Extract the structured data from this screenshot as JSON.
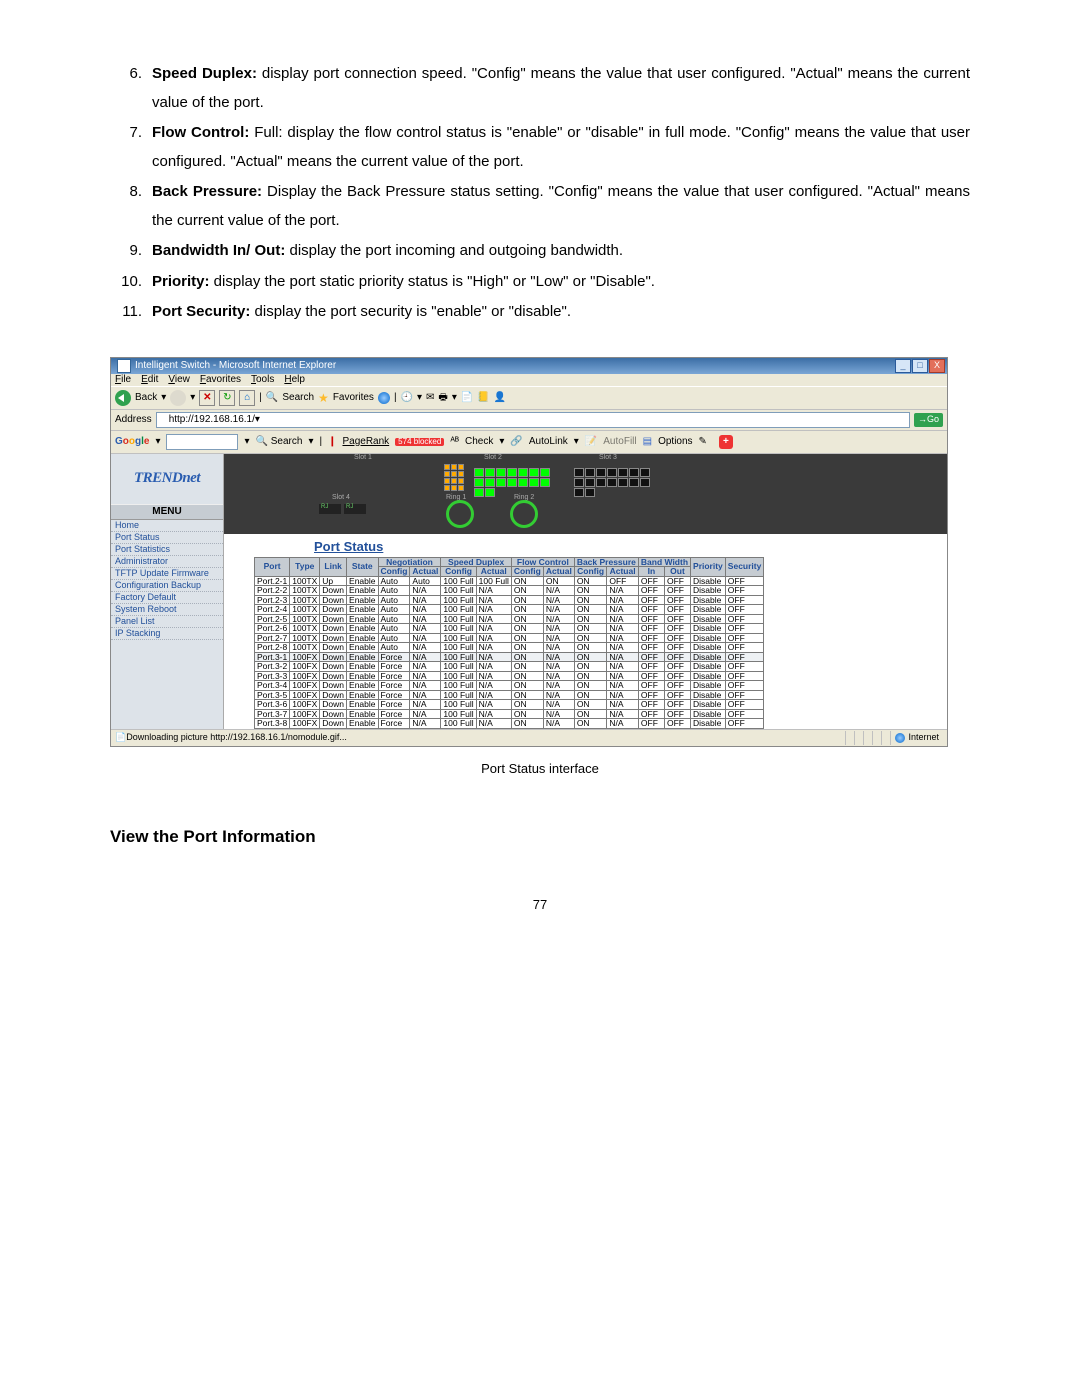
{
  "list": [
    {
      "n": "6.",
      "bold": "Speed Duplex:",
      "text": " display port connection speed. \"Config\" means the value that user configured. \"Actual\" means the current value of the port."
    },
    {
      "n": "7.",
      "bold": "Flow Control:",
      "text": " Full: display the flow control status is \"enable\" or \"disable\" in full mode. \"Config\" means the value that user configured. \"Actual\" means the current value of the port."
    },
    {
      "n": "8.",
      "bold": "Back Pressure:",
      "text": " Display the Back Pressure status setting. \"Config\" means the value that user configured. \"Actual\" means the current value of the port."
    },
    {
      "n": "9.",
      "bold": "Bandwidth In/ Out:",
      "text": " display the port incoming and outgoing bandwidth."
    },
    {
      "n": "10.",
      "bold": "Priority:",
      "text": " display the port static priority status is \"High\" or \"Low\" or \"Disable\"."
    },
    {
      "n": "11.",
      "bold": "Port Security:",
      "text": " display the port security is \"enable\" or \"disable\"."
    }
  ],
  "caption": "Port Status interface",
  "section_heading": "View the Port Information",
  "page_number": "77",
  "browser": {
    "title": "Intelligent Switch - Microsoft Internet Explorer",
    "menus": [
      "File",
      "Edit",
      "View",
      "Favorites",
      "Tools",
      "Help"
    ],
    "back": "Back",
    "search": "Search",
    "favorites": "Favorites",
    "address_label": "Address",
    "address_url": "http://192.168.16.1/",
    "go": "Go",
    "google": {
      "label": "Google",
      "search_btn": "Search",
      "pagerank": "PageRank",
      "blocked": "574 blocked",
      "check": "Check",
      "autolink": "AutoLink",
      "autofill": "AutoFill",
      "options": "Options"
    },
    "status": "Downloading picture http://192.168.16.1/nomodule.gif...",
    "zone": "Internet"
  },
  "sidebar": {
    "logo": "TRENDnet",
    "menu_header": "MENU",
    "items": [
      "Home",
      "Port Status",
      "Port Statistics",
      "Administrator",
      "TFTP Update Firmware",
      "Configuration Backup",
      "Factory Default",
      "System Reboot",
      "Panel List",
      "IP Stacking"
    ]
  },
  "content_title": "Port Status",
  "table": {
    "headers": {
      "port": "Port",
      "type": "Type",
      "link": "Link",
      "state": "State",
      "negotiation": "Negotiation",
      "speed_duplex": "Speed Duplex",
      "flow_control": "Flow Control",
      "back_pressure": "Back Pressure",
      "band_width": "Band Width",
      "priority": "Priority",
      "security": "Security",
      "config": "Config",
      "actual": "Actual",
      "in": "In",
      "out": "Out"
    },
    "rows": [
      {
        "port": "Port.2-1",
        "type": "100TX",
        "link": "Up",
        "state": "Enable",
        "nc": "Auto",
        "na": "Auto",
        "sc": "100 Full",
        "sa": "100 Full",
        "fc": "ON",
        "fa": "ON",
        "bc": "ON",
        "ba": "OFF",
        "bi": "OFF",
        "bo": "OFF",
        "pri": "Disable",
        "sec": "OFF"
      },
      {
        "port": "Port.2-2",
        "type": "100TX",
        "link": "Down",
        "state": "Enable",
        "nc": "Auto",
        "na": "N/A",
        "sc": "100 Full",
        "sa": "N/A",
        "fc": "ON",
        "fa": "N/A",
        "bc": "ON",
        "ba": "N/A",
        "bi": "OFF",
        "bo": "OFF",
        "pri": "Disable",
        "sec": "OFF"
      },
      {
        "port": "Port.2-3",
        "type": "100TX",
        "link": "Down",
        "state": "Enable",
        "nc": "Auto",
        "na": "N/A",
        "sc": "100 Full",
        "sa": "N/A",
        "fc": "ON",
        "fa": "N/A",
        "bc": "ON",
        "ba": "N/A",
        "bi": "OFF",
        "bo": "OFF",
        "pri": "Disable",
        "sec": "OFF"
      },
      {
        "port": "Port.2-4",
        "type": "100TX",
        "link": "Down",
        "state": "Enable",
        "nc": "Auto",
        "na": "N/A",
        "sc": "100 Full",
        "sa": "N/A",
        "fc": "ON",
        "fa": "N/A",
        "bc": "ON",
        "ba": "N/A",
        "bi": "OFF",
        "bo": "OFF",
        "pri": "Disable",
        "sec": "OFF"
      },
      {
        "port": "Port.2-5",
        "type": "100TX",
        "link": "Down",
        "state": "Enable",
        "nc": "Auto",
        "na": "N/A",
        "sc": "100 Full",
        "sa": "N/A",
        "fc": "ON",
        "fa": "N/A",
        "bc": "ON",
        "ba": "N/A",
        "bi": "OFF",
        "bo": "OFF",
        "pri": "Disable",
        "sec": "OFF"
      },
      {
        "port": "Port.2-6",
        "type": "100TX",
        "link": "Down",
        "state": "Enable",
        "nc": "Auto",
        "na": "N/A",
        "sc": "100 Full",
        "sa": "N/A",
        "fc": "ON",
        "fa": "N/A",
        "bc": "ON",
        "ba": "N/A",
        "bi": "OFF",
        "bo": "OFF",
        "pri": "Disable",
        "sec": "OFF"
      },
      {
        "port": "Port.2-7",
        "type": "100TX",
        "link": "Down",
        "state": "Enable",
        "nc": "Auto",
        "na": "N/A",
        "sc": "100 Full",
        "sa": "N/A",
        "fc": "ON",
        "fa": "N/A",
        "bc": "ON",
        "ba": "N/A",
        "bi": "OFF",
        "bo": "OFF",
        "pri": "Disable",
        "sec": "OFF"
      },
      {
        "port": "Port.2-8",
        "type": "100TX",
        "link": "Down",
        "state": "Enable",
        "nc": "Auto",
        "na": "N/A",
        "sc": "100 Full",
        "sa": "N/A",
        "fc": "ON",
        "fa": "N/A",
        "bc": "ON",
        "ba": "N/A",
        "bi": "OFF",
        "bo": "OFF",
        "pri": "Disable",
        "sec": "OFF"
      },
      {
        "port": "Port.3-1",
        "type": "100FX",
        "link": "Down",
        "state": "Enable",
        "nc": "Force",
        "na": "N/A",
        "sc": "100 Full",
        "sa": "N/A",
        "fc": "ON",
        "fa": "N/A",
        "bc": "ON",
        "ba": "N/A",
        "bi": "OFF",
        "bo": "OFF",
        "pri": "Disable",
        "sec": "OFF",
        "alt": true
      },
      {
        "port": "Port.3-2",
        "type": "100FX",
        "link": "Down",
        "state": "Enable",
        "nc": "Force",
        "na": "N/A",
        "sc": "100 Full",
        "sa": "N/A",
        "fc": "ON",
        "fa": "N/A",
        "bc": "ON",
        "ba": "N/A",
        "bi": "OFF",
        "bo": "OFF",
        "pri": "Disable",
        "sec": "OFF"
      },
      {
        "port": "Port.3-3",
        "type": "100FX",
        "link": "Down",
        "state": "Enable",
        "nc": "Force",
        "na": "N/A",
        "sc": "100 Full",
        "sa": "N/A",
        "fc": "ON",
        "fa": "N/A",
        "bc": "ON",
        "ba": "N/A",
        "bi": "OFF",
        "bo": "OFF",
        "pri": "Disable",
        "sec": "OFF"
      },
      {
        "port": "Port.3-4",
        "type": "100FX",
        "link": "Down",
        "state": "Enable",
        "nc": "Force",
        "na": "N/A",
        "sc": "100 Full",
        "sa": "N/A",
        "fc": "ON",
        "fa": "N/A",
        "bc": "ON",
        "ba": "N/A",
        "bi": "OFF",
        "bo": "OFF",
        "pri": "Disable",
        "sec": "OFF"
      },
      {
        "port": "Port.3-5",
        "type": "100FX",
        "link": "Down",
        "state": "Enable",
        "nc": "Force",
        "na": "N/A",
        "sc": "100 Full",
        "sa": "N/A",
        "fc": "ON",
        "fa": "N/A",
        "bc": "ON",
        "ba": "N/A",
        "bi": "OFF",
        "bo": "OFF",
        "pri": "Disable",
        "sec": "OFF"
      },
      {
        "port": "Port.3-6",
        "type": "100FX",
        "link": "Down",
        "state": "Enable",
        "nc": "Force",
        "na": "N/A",
        "sc": "100 Full",
        "sa": "N/A",
        "fc": "ON",
        "fa": "N/A",
        "bc": "ON",
        "ba": "N/A",
        "bi": "OFF",
        "bo": "OFF",
        "pri": "Disable",
        "sec": "OFF"
      },
      {
        "port": "Port.3-7",
        "type": "100FX",
        "link": "Down",
        "state": "Enable",
        "nc": "Force",
        "na": "N/A",
        "sc": "100 Full",
        "sa": "N/A",
        "fc": "ON",
        "fa": "N/A",
        "bc": "ON",
        "ba": "N/A",
        "bi": "OFF",
        "bo": "OFF",
        "pri": "Disable",
        "sec": "OFF"
      },
      {
        "port": "Port.3-8",
        "type": "100FX",
        "link": "Down",
        "state": "Enable",
        "nc": "Force",
        "na": "N/A",
        "sc": "100 Full",
        "sa": "N/A",
        "fc": "ON",
        "fa": "N/A",
        "bc": "ON",
        "ba": "N/A",
        "bi": "OFF",
        "bo": "OFF",
        "pri": "Disable",
        "sec": "OFF"
      }
    ]
  }
}
